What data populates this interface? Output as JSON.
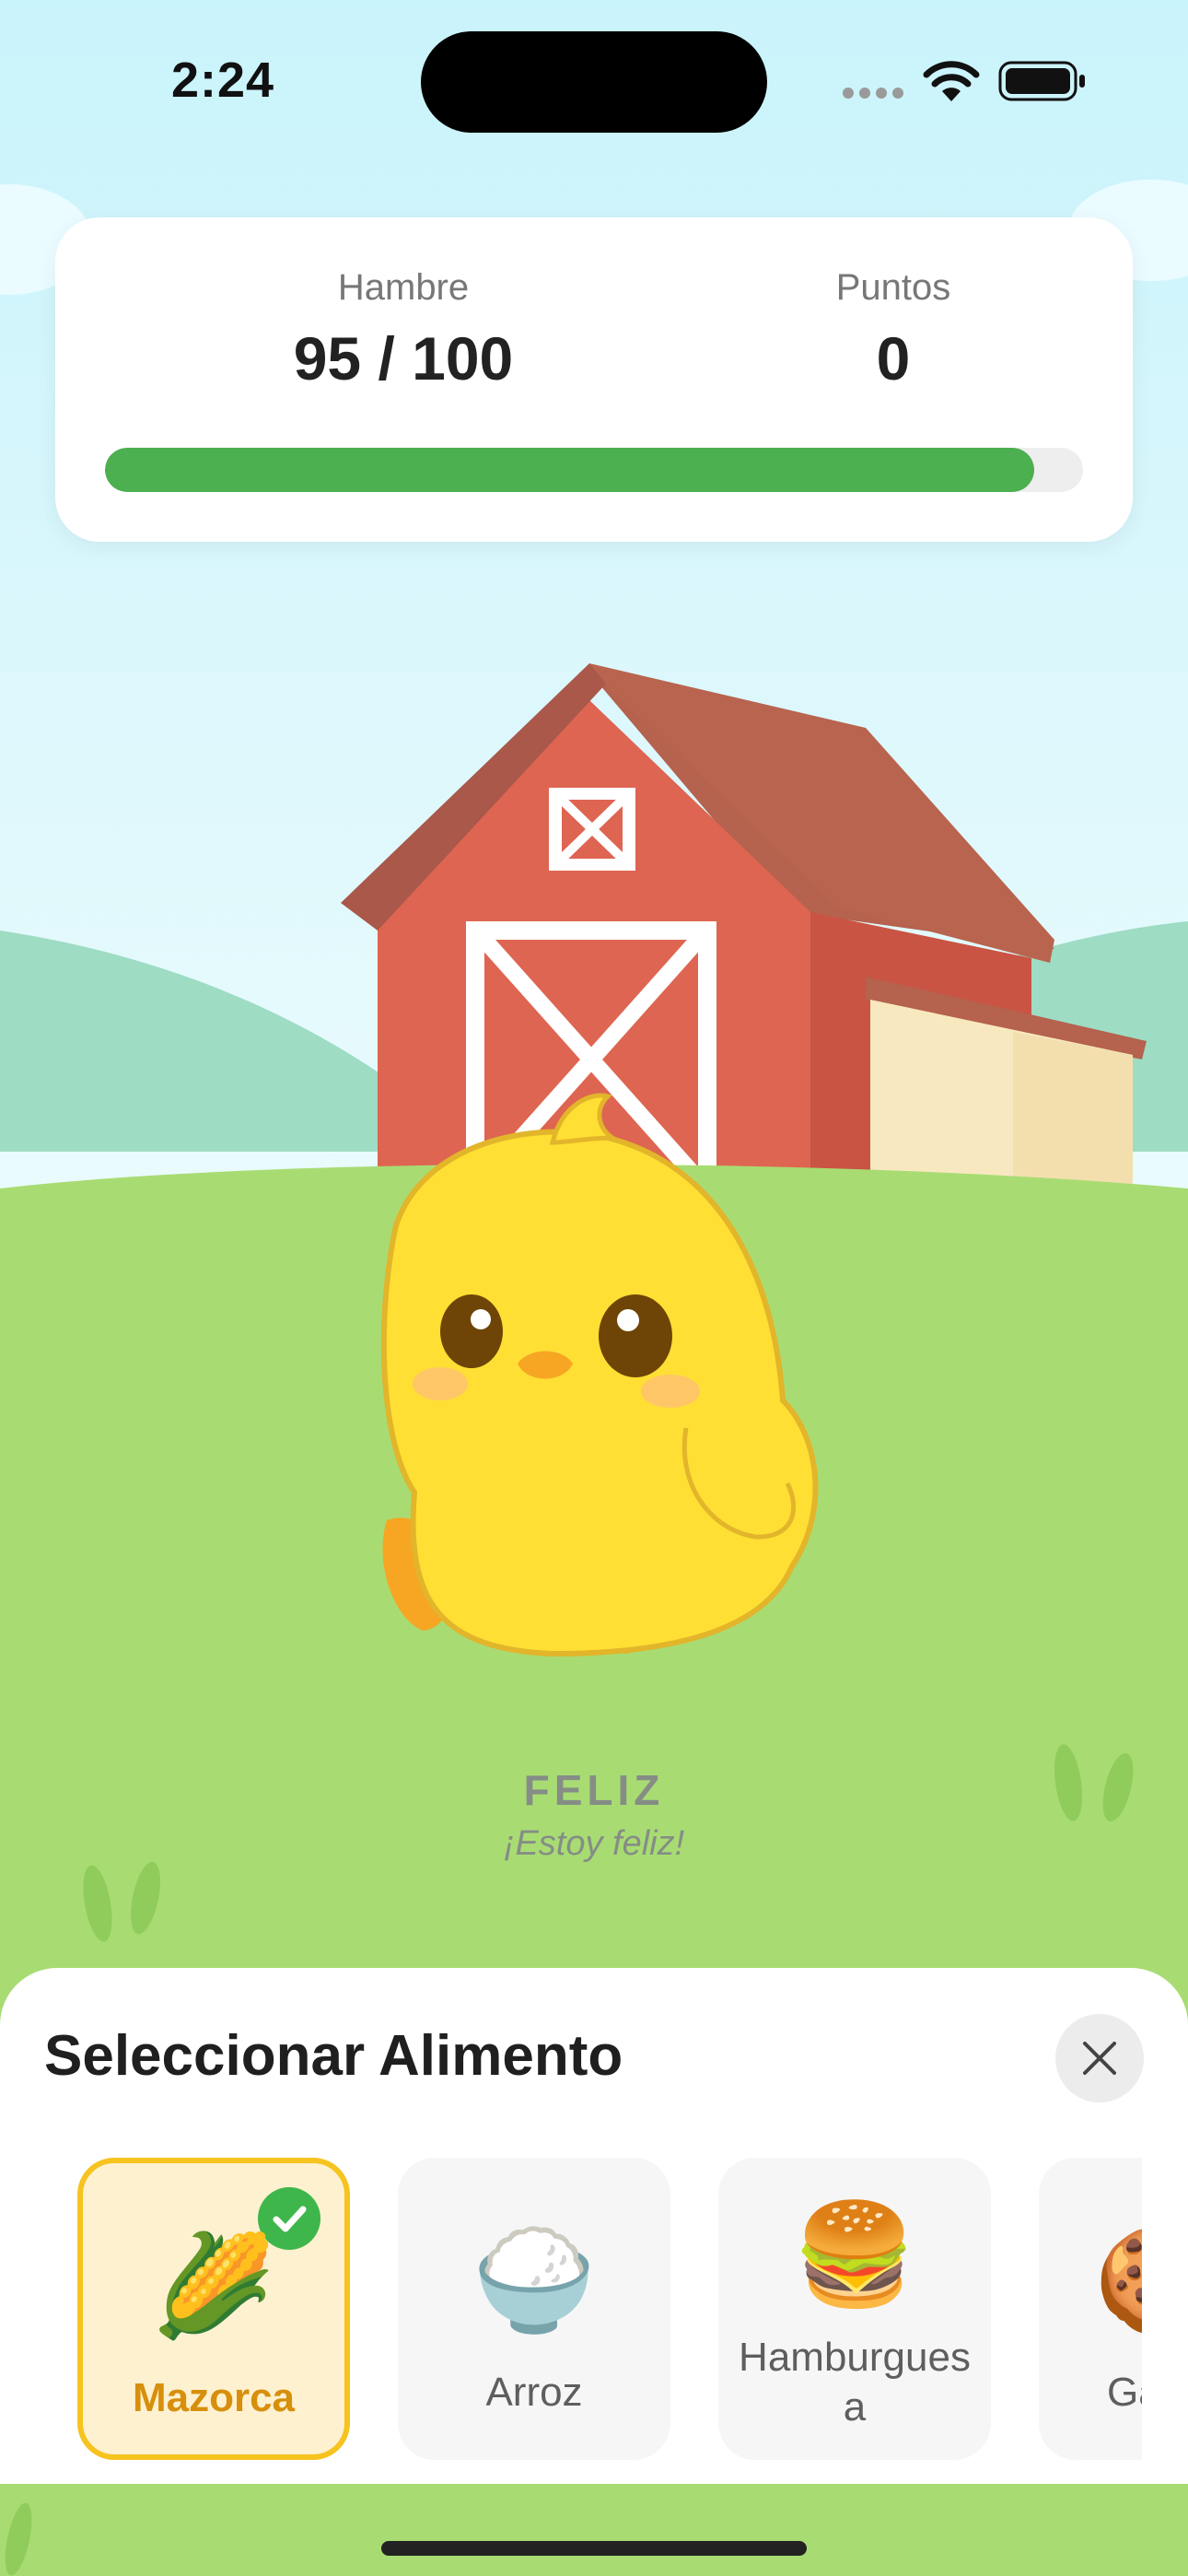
{
  "status_bar": {
    "time": "2:24",
    "icons": [
      "cellular-dots-icon",
      "wifi-icon",
      "battery-icon"
    ]
  },
  "stats": {
    "hunger_label": "Hambre",
    "hunger_value": "95 / 100",
    "hunger_fraction": 0.95,
    "points_label": "Puntos",
    "points_value": "0",
    "bar_color": "#4caf50"
  },
  "scene": {
    "background": "barn-farm-scene",
    "character": "yellow-chick"
  },
  "mood": {
    "title": "FELIZ",
    "subtitle": "¡Estoy feliz!"
  },
  "food_sheet": {
    "title": "Seleccionar Alimento",
    "close_icon": "close-icon",
    "items": [
      {
        "label": "Mazorca",
        "emoji": "🌽",
        "selected": true
      },
      {
        "label": "Arroz",
        "emoji": "🍚",
        "selected": false
      },
      {
        "label": "Hamburguesa",
        "emoji": "🍔",
        "selected": false
      },
      {
        "label": "Ga",
        "emoji": "🍪",
        "selected": false
      }
    ]
  },
  "colors": {
    "accent_selected": "#f6c31f",
    "selected_text": "#d78f0c",
    "check_green": "#3fb64b"
  }
}
